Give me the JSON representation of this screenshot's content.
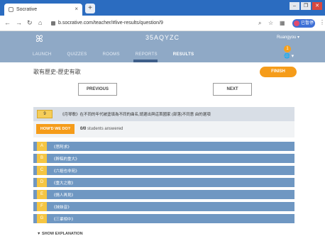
{
  "browser": {
    "tab_title": "Socrative",
    "tab_close": "×",
    "new_tab": "+",
    "url": "b.socrative.com/teacher/#live-results/question/9",
    "profile_label": "已暫停",
    "min": "–",
    "max": "❐",
    "close": "✕"
  },
  "header": {
    "logo": "ꕤ",
    "room_code": "35AQYZC",
    "account": "Ruangyou ▾",
    "notification_count": "1",
    "globe": "🌐 ▾",
    "nav": [
      {
        "label": "LAUNCH"
      },
      {
        "label": "QUIZZES"
      },
      {
        "label": "ROOMS"
      },
      {
        "label": "REPORTS"
      },
      {
        "label": "RESULTS"
      }
    ]
  },
  "quiz": {
    "title": "歌有歷史-歷史有歌",
    "finish_label": "FINISH",
    "previous_label": "PREVIOUS",
    "next_label": "NEXT",
    "question_number": "9",
    "question_text": "《月琴歌》在不同的年代被塗填為不同的曲名,請選出與這首國家 (部落)不同意 由的選項",
    "how_did_label": "HOW'D WE DO?",
    "answered_count": "0/0",
    "answered_suffix": " students answered",
    "choices": [
      {
        "letter": "A",
        "text": "《思阿求》"
      },
      {
        "letter": "B",
        "text": "《幹稿的重大》"
      },
      {
        "letter": "C",
        "text": "《六祖也非苑》"
      },
      {
        "letter": "D",
        "text": "《重大之歌》"
      },
      {
        "letter": "E",
        "text": "《情人再見》"
      },
      {
        "letter": "F",
        "text": "《妹妹音》"
      },
      {
        "letter": "G",
        "text": "《三輩相中》"
      }
    ],
    "show_explanation": "▼ SHOW EXPLANATION"
  }
}
